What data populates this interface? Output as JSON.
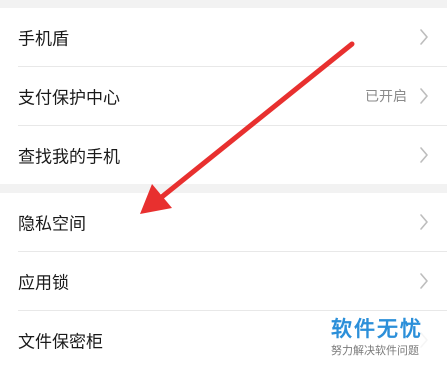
{
  "settings": {
    "items": [
      {
        "label": "手机盾",
        "value": ""
      },
      {
        "label": "支付保护中心",
        "value": "已开启"
      },
      {
        "label": "查找我的手机",
        "value": ""
      },
      {
        "label": "隐私空间",
        "value": ""
      },
      {
        "label": "应用锁",
        "value": ""
      },
      {
        "label": "文件保密柜",
        "value": ""
      }
    ]
  },
  "annotation": {
    "arrow_color": "#e8302f"
  },
  "watermark": {
    "title": "软件无忧",
    "subtitle": "努力解决软件问题"
  }
}
